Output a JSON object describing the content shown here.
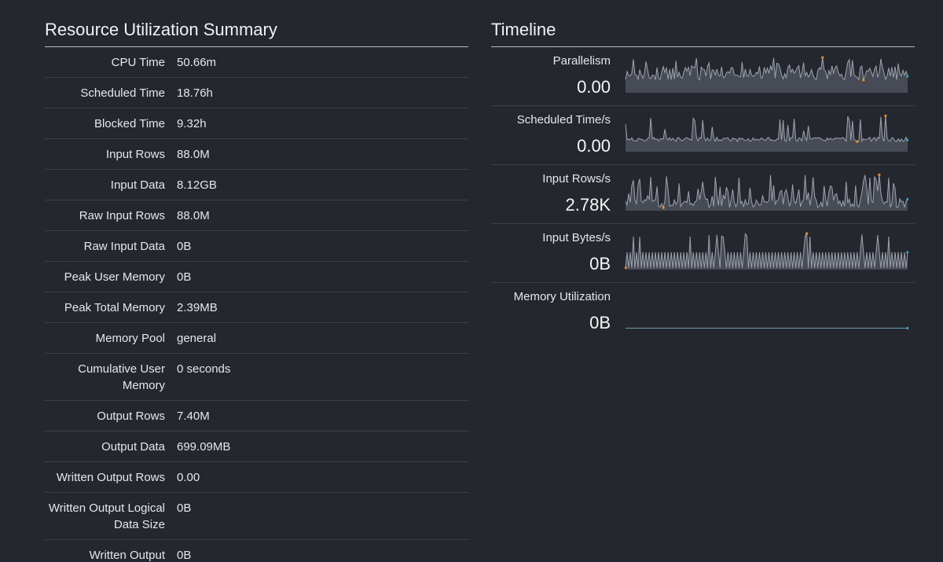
{
  "summary": {
    "title": "Resource Utilization Summary",
    "rows": [
      {
        "label": "CPU Time",
        "value": "50.66m"
      },
      {
        "label": "Scheduled Time",
        "value": "18.76h"
      },
      {
        "label": "Blocked Time",
        "value": "9.32h"
      },
      {
        "label": "Input Rows",
        "value": "88.0M"
      },
      {
        "label": "Input Data",
        "value": "8.12GB"
      },
      {
        "label": "Raw Input Rows",
        "value": "88.0M"
      },
      {
        "label": "Raw Input Data",
        "value": "0B"
      },
      {
        "label": "Peak User Memory",
        "value": "0B"
      },
      {
        "label": "Peak Total Memory",
        "value": "2.39MB"
      },
      {
        "label": "Memory Pool",
        "value": "general"
      },
      {
        "label": "Cumulative User Memory",
        "value": "0 seconds"
      },
      {
        "label": "Output Rows",
        "value": "7.40M"
      },
      {
        "label": "Output Data",
        "value": "699.09MB"
      },
      {
        "label": "Written Output Rows",
        "value": "0.00"
      },
      {
        "label": "Written Output Logical Data Size",
        "value": "0B"
      },
      {
        "label": "Written Output Physical Data Size",
        "value": "0B"
      }
    ]
  },
  "timeline": {
    "title": "Timeline",
    "rows": [
      {
        "label": "Parallelism",
        "value": "0.00",
        "pattern": "noisy",
        "seed": 3
      },
      {
        "label": "Scheduled Time/s",
        "value": "0.00",
        "pattern": "spiky",
        "seed": 7
      },
      {
        "label": "Input Rows/s",
        "value": "2.78K",
        "pattern": "bursty",
        "seed": 11
      },
      {
        "label": "Input Bytes/s",
        "value": "0B",
        "pattern": "square",
        "seed": 19
      },
      {
        "label": "Memory Utilization",
        "value": "0B",
        "pattern": "flat",
        "seed": 0
      }
    ]
  },
  "colors": {
    "background": "#25272e",
    "spark_fill": "#474b55",
    "spark_line": "#9da3ad",
    "marker_max": "#f08c2b",
    "marker_min": "#f08c2b",
    "marker_last": "#21b8d6"
  }
}
